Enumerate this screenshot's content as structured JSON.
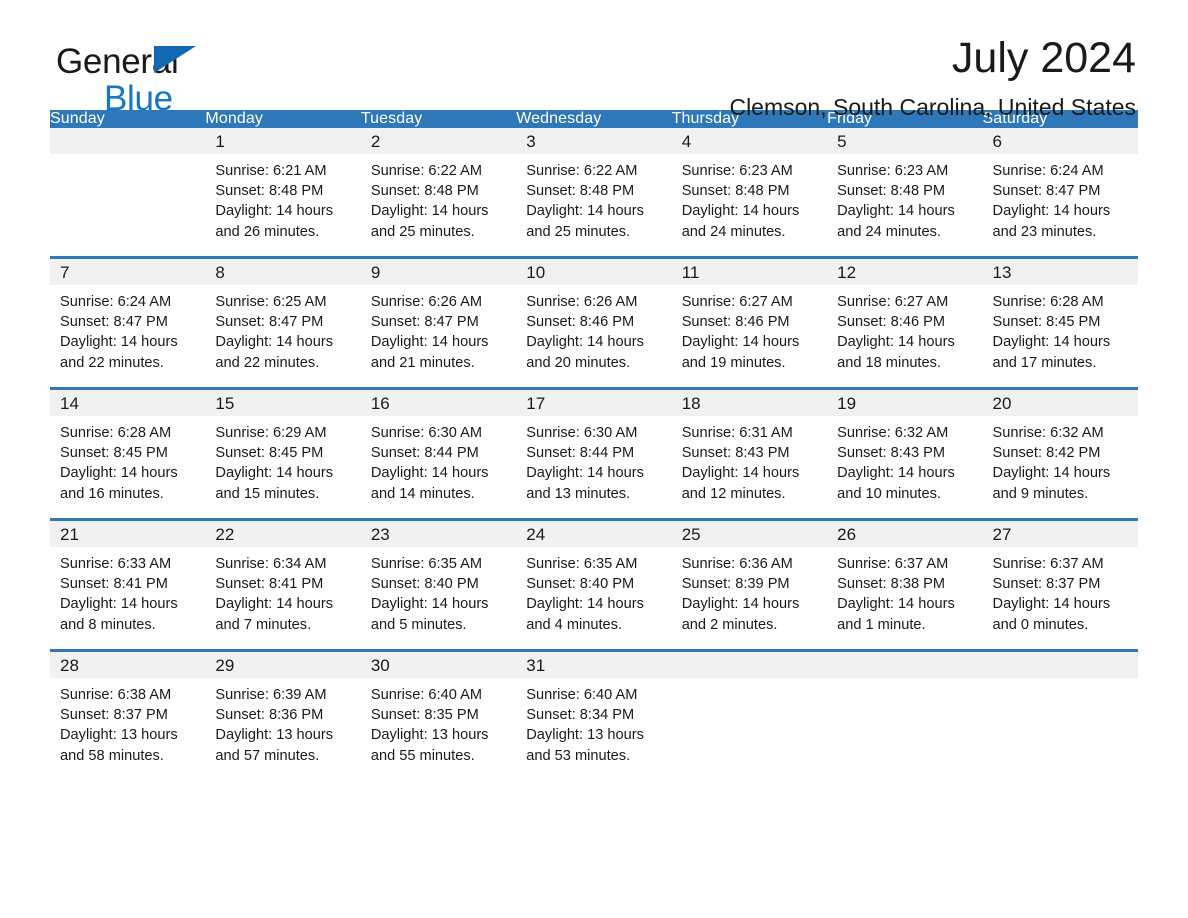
{
  "brand": {
    "name_line1": "General",
    "name_line2": "Blue",
    "triangle_icon": "triangle-icon",
    "accent_color": "#1268b3",
    "blue_text_color": "#1577c6"
  },
  "header": {
    "month_title": "July 2024",
    "location": "Clemson, South Carolina, United States"
  },
  "calendar": {
    "header_bg": "#2e77b8",
    "daynum_band_bg": "#f1f1f1",
    "weekdays": [
      "Sunday",
      "Monday",
      "Tuesday",
      "Wednesday",
      "Thursday",
      "Friday",
      "Saturday"
    ],
    "weeks": [
      [
        {
          "day": "",
          "info": ""
        },
        {
          "day": "1",
          "info": "Sunrise: 6:21 AM\nSunset: 8:48 PM\nDaylight: 14 hours and 26 minutes."
        },
        {
          "day": "2",
          "info": "Sunrise: 6:22 AM\nSunset: 8:48 PM\nDaylight: 14 hours and 25 minutes."
        },
        {
          "day": "3",
          "info": "Sunrise: 6:22 AM\nSunset: 8:48 PM\nDaylight: 14 hours and 25 minutes."
        },
        {
          "day": "4",
          "info": "Sunrise: 6:23 AM\nSunset: 8:48 PM\nDaylight: 14 hours and 24 minutes."
        },
        {
          "day": "5",
          "info": "Sunrise: 6:23 AM\nSunset: 8:48 PM\nDaylight: 14 hours and 24 minutes."
        },
        {
          "day": "6",
          "info": "Sunrise: 6:24 AM\nSunset: 8:47 PM\nDaylight: 14 hours and 23 minutes."
        }
      ],
      [
        {
          "day": "7",
          "info": "Sunrise: 6:24 AM\nSunset: 8:47 PM\nDaylight: 14 hours and 22 minutes."
        },
        {
          "day": "8",
          "info": "Sunrise: 6:25 AM\nSunset: 8:47 PM\nDaylight: 14 hours and 22 minutes."
        },
        {
          "day": "9",
          "info": "Sunrise: 6:26 AM\nSunset: 8:47 PM\nDaylight: 14 hours and 21 minutes."
        },
        {
          "day": "10",
          "info": "Sunrise: 6:26 AM\nSunset: 8:46 PM\nDaylight: 14 hours and 20 minutes."
        },
        {
          "day": "11",
          "info": "Sunrise: 6:27 AM\nSunset: 8:46 PM\nDaylight: 14 hours and 19 minutes."
        },
        {
          "day": "12",
          "info": "Sunrise: 6:27 AM\nSunset: 8:46 PM\nDaylight: 14 hours and 18 minutes."
        },
        {
          "day": "13",
          "info": "Sunrise: 6:28 AM\nSunset: 8:45 PM\nDaylight: 14 hours and 17 minutes."
        }
      ],
      [
        {
          "day": "14",
          "info": "Sunrise: 6:28 AM\nSunset: 8:45 PM\nDaylight: 14 hours and 16 minutes."
        },
        {
          "day": "15",
          "info": "Sunrise: 6:29 AM\nSunset: 8:45 PM\nDaylight: 14 hours and 15 minutes."
        },
        {
          "day": "16",
          "info": "Sunrise: 6:30 AM\nSunset: 8:44 PM\nDaylight: 14 hours and 14 minutes."
        },
        {
          "day": "17",
          "info": "Sunrise: 6:30 AM\nSunset: 8:44 PM\nDaylight: 14 hours and 13 minutes."
        },
        {
          "day": "18",
          "info": "Sunrise: 6:31 AM\nSunset: 8:43 PM\nDaylight: 14 hours and 12 minutes."
        },
        {
          "day": "19",
          "info": "Sunrise: 6:32 AM\nSunset: 8:43 PM\nDaylight: 14 hours and 10 minutes."
        },
        {
          "day": "20",
          "info": "Sunrise: 6:32 AM\nSunset: 8:42 PM\nDaylight: 14 hours and 9 minutes."
        }
      ],
      [
        {
          "day": "21",
          "info": "Sunrise: 6:33 AM\nSunset: 8:41 PM\nDaylight: 14 hours and 8 minutes."
        },
        {
          "day": "22",
          "info": "Sunrise: 6:34 AM\nSunset: 8:41 PM\nDaylight: 14 hours and 7 minutes."
        },
        {
          "day": "23",
          "info": "Sunrise: 6:35 AM\nSunset: 8:40 PM\nDaylight: 14 hours and 5 minutes."
        },
        {
          "day": "24",
          "info": "Sunrise: 6:35 AM\nSunset: 8:40 PM\nDaylight: 14 hours and 4 minutes."
        },
        {
          "day": "25",
          "info": "Sunrise: 6:36 AM\nSunset: 8:39 PM\nDaylight: 14 hours and 2 minutes."
        },
        {
          "day": "26",
          "info": "Sunrise: 6:37 AM\nSunset: 8:38 PM\nDaylight: 14 hours and 1 minute."
        },
        {
          "day": "27",
          "info": "Sunrise: 6:37 AM\nSunset: 8:37 PM\nDaylight: 14 hours and 0 minutes."
        }
      ],
      [
        {
          "day": "28",
          "info": "Sunrise: 6:38 AM\nSunset: 8:37 PM\nDaylight: 13 hours and 58 minutes."
        },
        {
          "day": "29",
          "info": "Sunrise: 6:39 AM\nSunset: 8:36 PM\nDaylight: 13 hours and 57 minutes."
        },
        {
          "day": "30",
          "info": "Sunrise: 6:40 AM\nSunset: 8:35 PM\nDaylight: 13 hours and 55 minutes."
        },
        {
          "day": "31",
          "info": "Sunrise: 6:40 AM\nSunset: 8:34 PM\nDaylight: 13 hours and 53 minutes."
        },
        {
          "day": "",
          "info": ""
        },
        {
          "day": "",
          "info": ""
        },
        {
          "day": "",
          "info": ""
        }
      ]
    ]
  }
}
